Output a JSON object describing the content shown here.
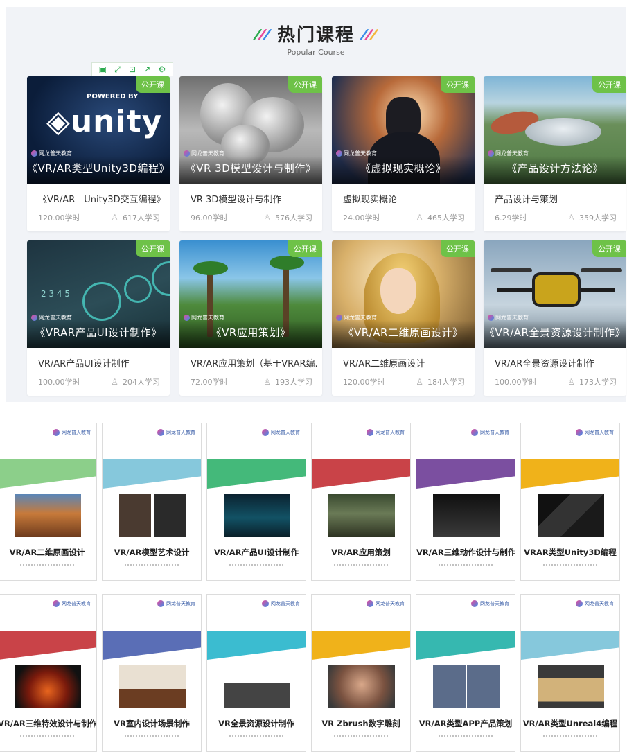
{
  "popular": {
    "title": "热门课程",
    "subtitle": "Popular Course",
    "deco_colors": [
      "#2dab4f",
      "#e84a9a",
      "#f4b63c",
      "#3c8de8"
    ],
    "toolbar": [
      "save-icon",
      "expand-icon",
      "screenshot-icon",
      "share-icon",
      "settings-icon"
    ],
    "brand_text": "网龙普天教育",
    "badge_color": "#6ec248",
    "courses": [
      {
        "badge": "公开课",
        "cover_title": "《VR/AR类型Unity3D编程》",
        "name": "《VR/AR—Unity3D交互编程》",
        "hours": "120.00学时",
        "learners": "617人学习",
        "art": "unity"
      },
      {
        "badge": "公开课",
        "cover_title": "《VR 3D模型设计与制作》",
        "name": "VR 3D模型设计与制作",
        "hours": "96.00学时",
        "learners": "576人学习",
        "art": "model"
      },
      {
        "badge": "公开课",
        "cover_title": "《虚拟现实概论》",
        "name": "虚拟现实概论",
        "hours": "24.00学时",
        "learners": "465人学习",
        "art": "vr"
      },
      {
        "badge": "公开课",
        "cover_title": "《产品设计方法论》",
        "name": "产品设计与策划",
        "hours": "6.29学时",
        "learners": "359人学习",
        "art": "campus"
      },
      {
        "badge": "公开课",
        "cover_title": "《VRAR产品UI设计制作》",
        "name": "VR/AR产品UI设计制作",
        "hours": "100.00学时",
        "learners": "204人学习",
        "art": "ui"
      },
      {
        "badge": "公开课",
        "cover_title": "《VR应用策划》",
        "name": "VR/AR应用策划（基于VRAR编...",
        "hours": "72.00学时",
        "learners": "193人学习",
        "art": "jungle"
      },
      {
        "badge": "公开课",
        "cover_title": "《VR/AR二维原画设计》",
        "name": "VR/AR二维原画设计",
        "hours": "120.00学时",
        "learners": "184人学习",
        "art": "girl"
      },
      {
        "badge": "公开课",
        "cover_title": "《VR/AR全景资源设计制作》",
        "name": "VR/AR全景资源设计制作",
        "hours": "100.00学时",
        "learners": "173人学习",
        "art": "drone"
      }
    ]
  },
  "books": {
    "brand_text": "网龙普天教育",
    "items": [
      {
        "title": "VR/AR二维原画设计",
        "band": "#8ccf8a",
        "img": "img-a"
      },
      {
        "title": "VR/AR模型艺术设计",
        "band": "#86c8dc",
        "img": "img-b"
      },
      {
        "title": "VR/AR产品UI设计制作",
        "band": "#44b97a",
        "img": "img-c"
      },
      {
        "title": "VR/AR应用策划",
        "band": "#c94348",
        "img": "img-d"
      },
      {
        "title": "VR/AR三维动作设计与制作",
        "band": "#7b4fa0",
        "img": "img-e"
      },
      {
        "title": "VRAR类型Unity3D编程",
        "band": "#f0b21a",
        "img": "img-f"
      },
      {
        "title": "VR/AR三维特效设计与制作",
        "band": "#c94348",
        "img": "img-g"
      },
      {
        "title": "VR室内设计场景制作",
        "band": "#5a6eb6",
        "img": "img-h"
      },
      {
        "title": "VR全景资源设计制作",
        "band": "#3bbcd0",
        "img": "img-i"
      },
      {
        "title": "VR Zbrush数字雕刻",
        "band": "#f0b21a",
        "img": "img-j"
      },
      {
        "title": "VR/AR类型APP产品策划",
        "band": "#36b8b0",
        "img": "img-k"
      },
      {
        "title": "VR/AR类型Unreal4编程",
        "band": "#86c8dc",
        "img": "img-l"
      }
    ]
  }
}
